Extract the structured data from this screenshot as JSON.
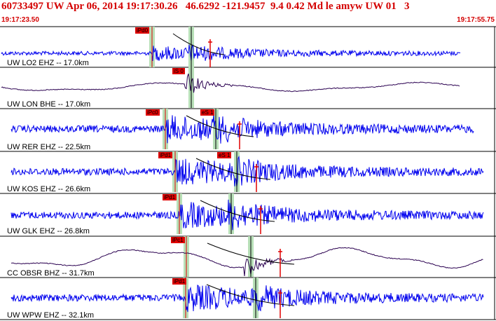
{
  "header": {
    "title": "60733497 UW Apr 06, 2014 19:17:30.26   46.6292 -121.9457  9.4 0.42 Md le amyw UW 01   3",
    "start_time": "19:17:23.50",
    "end_time": "19:17:55.75"
  },
  "colors": {
    "trace_blue": "#0000ee",
    "trace_dark": "#2a0050",
    "pick_red": "#e00000",
    "p_band_green": "#b8e0b8",
    "header_red": "#d40000"
  },
  "traces": [
    {
      "label": "UW LO2 EHZ -- 17.0km",
      "p_pick": "iPd0",
      "s_pick": "",
      "style": "blue"
    },
    {
      "label": "UW LON BHE -- 17.0km",
      "p_pick": "",
      "s_pick": "iS 0",
      "style": "dark"
    },
    {
      "label": "UW RER EHZ -- 22.5km",
      "p_pick": "iPc0",
      "s_pick": "eS 1",
      "style": "blue"
    },
    {
      "label": "UW KOS EHZ -- 26.6km",
      "p_pick": "iPd1",
      "s_pick": "eS 1",
      "style": "blue"
    },
    {
      "label": "UW GLK EHZ -- 26.8km",
      "p_pick": "iPd1",
      "s_pick": "",
      "style": "blue"
    },
    {
      "label": "CC OBSR BHZ -- 31.7km",
      "p_pick": "iPc1",
      "s_pick": "",
      "style": "dark"
    },
    {
      "label": "UW WPW EHZ -- 32.1km",
      "p_pick": "iPd1",
      "s_pick": "",
      "style": "blue"
    }
  ]
}
